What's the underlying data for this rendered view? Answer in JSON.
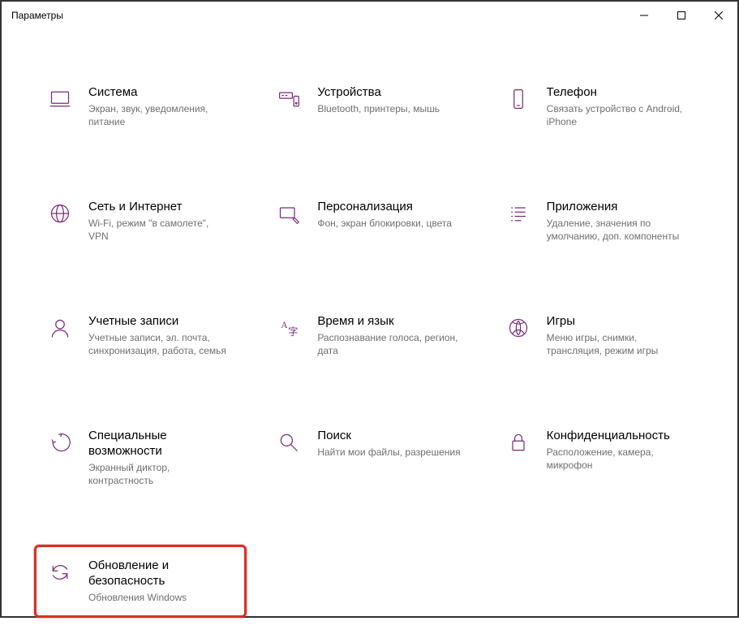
{
  "window": {
    "title": "Параметры"
  },
  "tiles": [
    {
      "title": "Система",
      "desc": "Экран, звук, уведомления, питание"
    },
    {
      "title": "Устройства",
      "desc": "Bluetooth, принтеры, мышь"
    },
    {
      "title": "Телефон",
      "desc": "Связать устройство с Android, iPhone"
    },
    {
      "title": "Сеть и Интернет",
      "desc": "Wi-Fi, режим \"в самолете\", VPN"
    },
    {
      "title": "Персонализация",
      "desc": "Фон, экран блокировки, цвета"
    },
    {
      "title": "Приложения",
      "desc": "Удаление, значения по умолчанию, доп. компоненты"
    },
    {
      "title": "Учетные записи",
      "desc": "Учетные записи, эл. почта, синхронизация, работа, семья"
    },
    {
      "title": "Время и язык",
      "desc": "Распознавание голоса, регион, дата"
    },
    {
      "title": "Игры",
      "desc": "Меню игры, снимки, трансляция, режим игры"
    },
    {
      "title": "Специальные возможности",
      "desc": "Экранный диктор, контрастность"
    },
    {
      "title": "Поиск",
      "desc": "Найти мои файлы, разрешения"
    },
    {
      "title": "Конфиденциальность",
      "desc": "Расположение, камера, микрофон"
    },
    {
      "title": "Обновление и безопасность",
      "desc": "Обновления Windows"
    }
  ]
}
